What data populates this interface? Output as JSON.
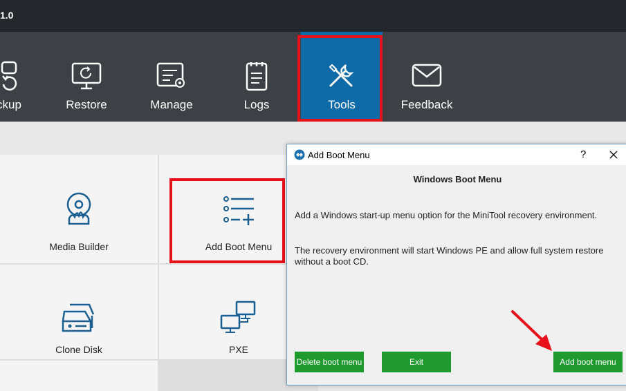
{
  "titlebar": {
    "title": "1.0"
  },
  "toolbar": {
    "items": [
      {
        "label": "ckup",
        "icon": "backup-icon"
      },
      {
        "label": "Restore",
        "icon": "restore-icon"
      },
      {
        "label": "Manage",
        "icon": "manage-icon"
      },
      {
        "label": "Logs",
        "icon": "logs-icon"
      },
      {
        "label": "Tools",
        "icon": "tools-icon",
        "active": true
      },
      {
        "label": "Feedback",
        "icon": "feedback-icon"
      }
    ]
  },
  "grid": {
    "tiles": [
      {
        "label": "Media Builder",
        "icon": "media-builder-icon"
      },
      {
        "label": "Add Boot Menu",
        "icon": "add-boot-menu-icon"
      },
      {
        "label": "Clone Disk",
        "icon": "clone-disk-icon"
      },
      {
        "label": "PXE",
        "icon": "pxe-icon"
      }
    ]
  },
  "dialog": {
    "title": "Add Boot Menu",
    "help": "?",
    "heading": "Windows Boot Menu",
    "paragraph1": "Add a Windows start-up menu option for the MiniTool recovery environment.",
    "paragraph2": "The recovery environment will start Windows PE and allow full system restore without a boot CD.",
    "buttons": {
      "delete": "Delete boot menu",
      "exit": "Exit",
      "add": "Add boot menu"
    }
  },
  "colors": {
    "titlebar_bg": "#24272b",
    "toolbar_bg": "#3d4044",
    "active_tab": "#0f6aa8",
    "highlight_red": "#e8101b",
    "button_green": "#1f9a2f",
    "icon_blue": "#1b5f91"
  }
}
